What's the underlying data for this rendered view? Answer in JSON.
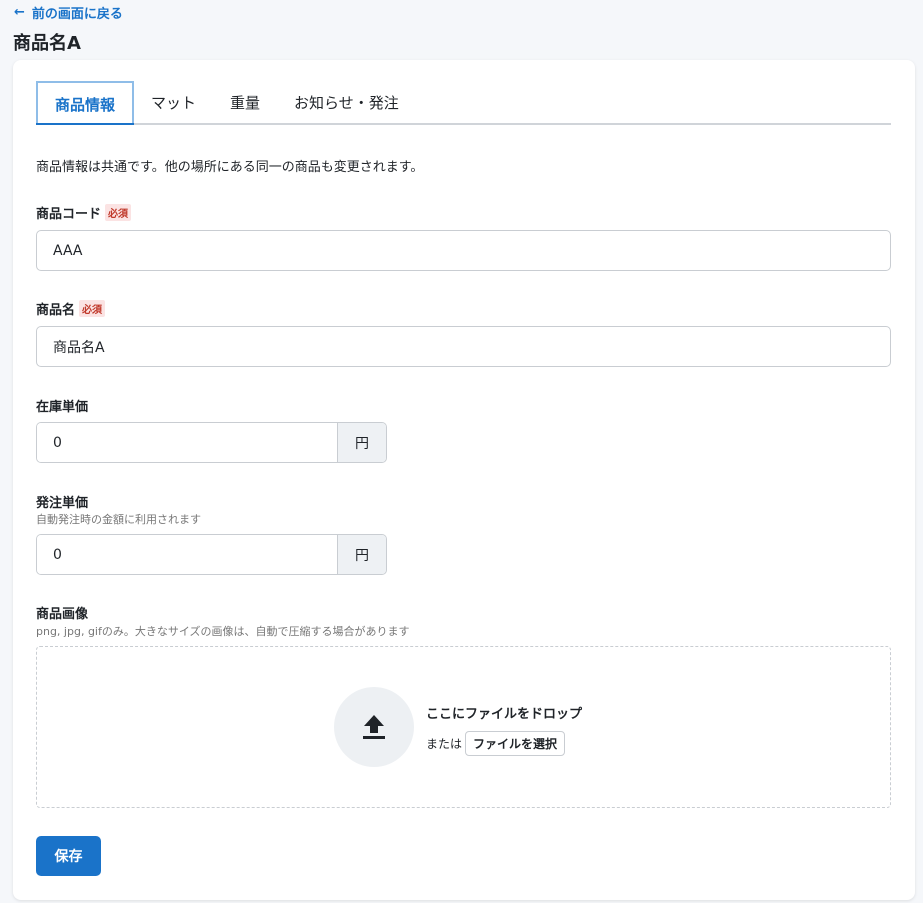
{
  "nav": {
    "back_label": "前の画面に戻る"
  },
  "page": {
    "title": "商品名A"
  },
  "tabs": [
    {
      "label": "商品情報",
      "active": true
    },
    {
      "label": "マット"
    },
    {
      "label": "重量"
    },
    {
      "label": "お知らせ・発注"
    }
  ],
  "note": "商品情報は共通です。他の場所にある同一の商品も変更されます。",
  "required_badge": "必須",
  "fields": {
    "code": {
      "label": "商品コード",
      "value": "AAA"
    },
    "name": {
      "label": "商品名",
      "value": "商品名A"
    },
    "stock_price": {
      "label": "在庫単価",
      "value": "0",
      "unit": "円"
    },
    "order_price": {
      "label": "発注単価",
      "hint": "自動発注時の金額に利用されます",
      "value": "0",
      "unit": "円"
    },
    "image": {
      "label": "商品画像",
      "hint": "png, jpg, gifのみ。大きなサイズの画像は、自動で圧縮する場合があります",
      "drop_title": "ここにファイルをドロップ",
      "or_text": "または",
      "choose_label": "ファイルを選択"
    }
  },
  "actions": {
    "save_label": "保存"
  },
  "colors": {
    "accent": "#1a73c9",
    "required_text": "#c0392b",
    "required_bg": "#fbe3e3"
  }
}
